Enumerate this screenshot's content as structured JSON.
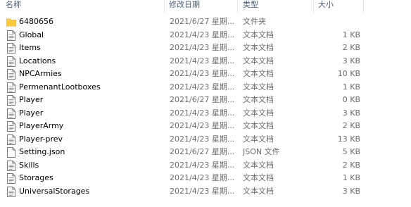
{
  "columns": {
    "name": "名称",
    "date": "修改日期",
    "type": "类型",
    "size": "大小"
  },
  "files": [
    {
      "name": "6480656",
      "date": "2021/6/27 星期...",
      "type": "文件夹",
      "size": "",
      "icon": "folder-icon"
    },
    {
      "name": "Global",
      "date": "2021/4/23 星期...",
      "type": "文本文档",
      "size": "1 KB",
      "icon": "text-file-icon"
    },
    {
      "name": "Items",
      "date": "2021/4/23 星期...",
      "type": "文本文档",
      "size": "2 KB",
      "icon": "text-file-icon"
    },
    {
      "name": "Locations",
      "date": "2021/4/23 星期...",
      "type": "文本文档",
      "size": "3 KB",
      "icon": "text-file-icon"
    },
    {
      "name": "NPCArmies",
      "date": "2021/4/23 星期...",
      "type": "文本文档",
      "size": "10 KB",
      "icon": "text-file-icon"
    },
    {
      "name": "PermenantLootboxes",
      "date": "2021/4/23 星期...",
      "type": "文本文档",
      "size": "1 KB",
      "icon": "text-file-icon"
    },
    {
      "name": "Player",
      "date": "2021/6/27 星期...",
      "type": "文本文档",
      "size": "0 KB",
      "icon": "text-file-icon"
    },
    {
      "name": "Player",
      "date": "2021/4/23 星期...",
      "type": "文本文档",
      "size": "3 KB",
      "icon": "text-file-icon"
    },
    {
      "name": "PlayerArmy",
      "date": "2021/4/23 星期...",
      "type": "文本文档",
      "size": "2 KB",
      "icon": "text-file-icon"
    },
    {
      "name": "Player-prev",
      "date": "2021/4/23 星期...",
      "type": "文本文档",
      "size": "13 KB",
      "icon": "text-file-icon"
    },
    {
      "name": "Setting.json",
      "date": "2021/6/27 星期...",
      "type": "JSON 文件",
      "size": "5 KB",
      "icon": "blank-file-icon"
    },
    {
      "name": "Skills",
      "date": "2021/4/23 星期...",
      "type": "文本文档",
      "size": "2 KB",
      "icon": "text-file-icon"
    },
    {
      "name": "Storages",
      "date": "2021/4/23 星期...",
      "type": "文本文档",
      "size": "1 KB",
      "icon": "text-file-icon"
    },
    {
      "name": "UniversalStorages",
      "date": "2021/4/23 星期...",
      "type": "文本文档",
      "size": "3 KB",
      "icon": "text-file-icon"
    }
  ]
}
